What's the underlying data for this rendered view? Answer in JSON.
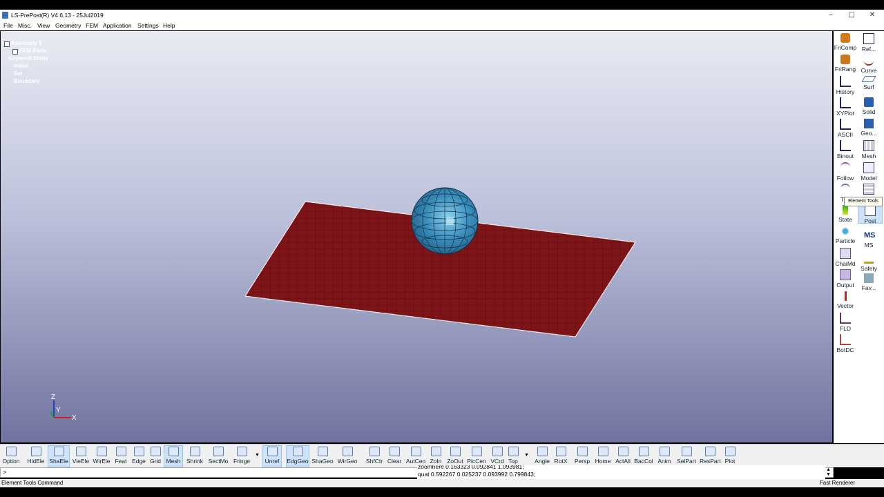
{
  "window": {
    "title": "LS-PrePost(R) V4.6.13 - 25Jul2019",
    "min": "–",
    "max": "▢",
    "close": "✕"
  },
  "menu": [
    "File",
    "Misc.",
    "View",
    "Geometry",
    "FEM",
    "Application",
    "Settings",
    "Help"
  ],
  "tree": [
    {
      "label": "Assembly 1",
      "indent": 0
    },
    {
      "label": "FEM Parts",
      "indent": 1
    },
    {
      "label": "Keyword Entity",
      "indent": 0
    },
    {
      "label": "Initial",
      "indent": 1
    },
    {
      "label": "Set",
      "indent": 1
    },
    {
      "label": "Boundary",
      "indent": 1
    }
  ],
  "right_panel": {
    "left_col": [
      "FriComp",
      "FriRang",
      "History",
      "XYPlot",
      "ASCII",
      "Binout",
      "Follow",
      "Tr...",
      "State",
      "Particle",
      "ChaiMd",
      "Output",
      "Vector",
      "FLD",
      "BotDC"
    ],
    "right_col": [
      "Ref...",
      "Curve",
      "Surf",
      "Solid",
      "Geo...",
      "Mesh",
      "Model",
      "",
      "Post",
      "MS",
      "Safety",
      "Fav..."
    ],
    "tooltip": "Element Tools",
    "colors": {
      "accent": "#2b6cb8",
      "active_bg": "#cfe3f8"
    }
  },
  "toolbar": [
    {
      "label": "Option",
      "icon": "option-icon"
    },
    {
      "label": "HidEle",
      "icon": "hidden-element-icon"
    },
    {
      "label": "ShaEle",
      "icon": "shade-element-icon",
      "active": true
    },
    {
      "label": "VieEle",
      "icon": "view-element-icon"
    },
    {
      "label": "WirEle",
      "icon": "wire-element-icon"
    },
    {
      "label": "Feat",
      "icon": "feature-icon"
    },
    {
      "label": "Edge",
      "icon": "edge-icon"
    },
    {
      "label": "Grid",
      "icon": "grid-icon"
    },
    {
      "label": "Mesh",
      "icon": "mesh-icon",
      "active": true
    },
    {
      "label": "Shrink",
      "icon": "shrink-icon"
    },
    {
      "label": "SectMo",
      "icon": "section-icon"
    },
    {
      "label": "Fringe",
      "icon": "fringe-icon"
    },
    {
      "label": "Unref",
      "icon": "unref-icon",
      "active": true
    },
    {
      "label": "EdgGeo",
      "icon": "edge-geometry-icon",
      "active": true
    },
    {
      "label": "ShaGeo",
      "icon": "shade-geometry-icon"
    },
    {
      "label": "WirGeo",
      "icon": "wire-geometry-icon"
    },
    {
      "label": "ShfCtr",
      "icon": "shift-ctrl-icon"
    },
    {
      "label": "Clear",
      "icon": "clear-icon"
    },
    {
      "label": "AutCen",
      "icon": "auto-center-icon"
    },
    {
      "label": "ZoIn",
      "icon": "zoom-in-icon"
    },
    {
      "label": "ZoOut",
      "icon": "zoom-out-icon"
    },
    {
      "label": "PicCen",
      "icon": "pick-center-icon"
    },
    {
      "label": "VCrd",
      "icon": "view-coord-icon"
    },
    {
      "label": "Top",
      "icon": "top-view-icon"
    },
    {
      "label": "Angle",
      "icon": "angle-icon"
    },
    {
      "label": "RotX",
      "icon": "rotate-x-icon"
    },
    {
      "label": "Persp",
      "icon": "perspective-icon"
    },
    {
      "label": "Home",
      "icon": "home-icon"
    },
    {
      "label": "ActAll",
      "icon": "activate-all-icon"
    },
    {
      "label": "BacCol",
      "icon": "background-color-icon"
    },
    {
      "label": "Anim",
      "icon": "animate-icon"
    },
    {
      "label": "SelPart",
      "icon": "select-part-icon"
    },
    {
      "label": "ResPart",
      "icon": "restore-part-icon"
    },
    {
      "label": "Plot",
      "icon": "plot-icon"
    }
  ],
  "toolbar_extra": {
    "unref_top": "U",
    "shfctr_top": "Shft\nCtrl",
    "angle_value": "10"
  },
  "command": {
    "prompt": ">"
  },
  "messages": [
    "zoomhere 0.163323 0.092841 1.093981;",
    "quat 0.592267 0.025237 0.093992 0.799843;"
  ],
  "status": {
    "left": "Element Tools Command",
    "right": "Fast Renderer"
  },
  "axes": {
    "z": "Z",
    "y": "Y",
    "x": "X"
  }
}
